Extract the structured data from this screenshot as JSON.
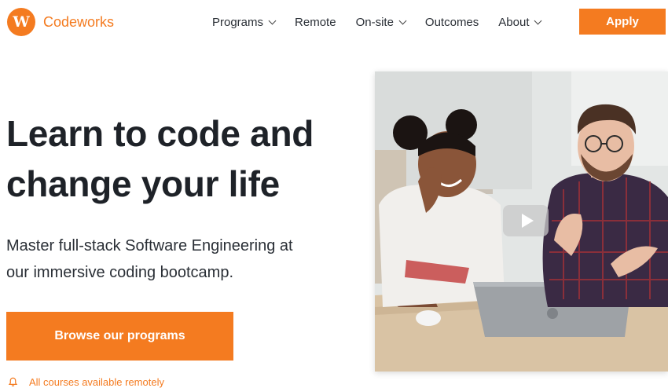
{
  "header": {
    "logo_letter": "W",
    "brand": "Codeworks",
    "nav": [
      {
        "label": "Programs",
        "dropdown": true
      },
      {
        "label": "Remote",
        "dropdown": false
      },
      {
        "label": "On-site",
        "dropdown": true
      },
      {
        "label": "Outcomes",
        "dropdown": false
      },
      {
        "label": "About",
        "dropdown": true
      }
    ],
    "apply_label": "Apply"
  },
  "hero": {
    "title_line1": "Learn to code and",
    "title_line2": "change your life",
    "subtitle_line1": "Master full-stack Software Engineering at",
    "subtitle_line2": "our immersive coding bootcamp.",
    "cta_label": "Browse our programs",
    "note": "All courses available remotely",
    "note_icon": "bell-icon",
    "media_icon": "play-icon"
  },
  "colors": {
    "accent": "#f47b20",
    "text": "#1e2228"
  }
}
